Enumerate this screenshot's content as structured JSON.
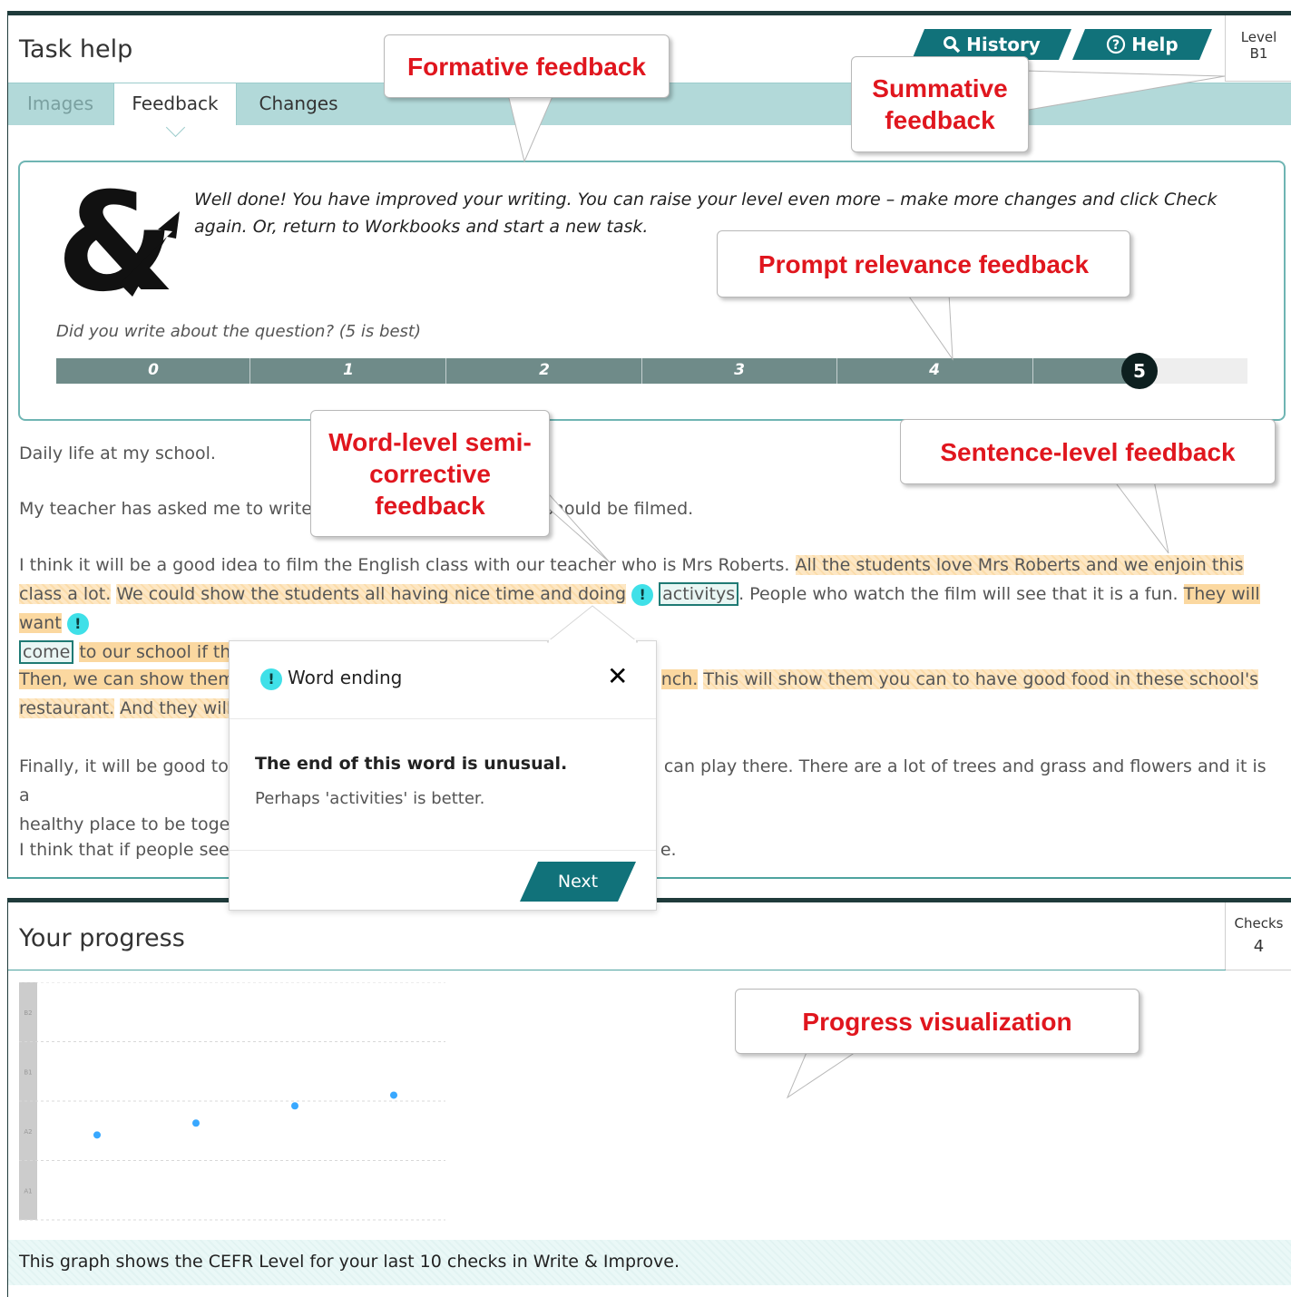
{
  "task_panel": {
    "title": "Task help",
    "history_label": "History",
    "help_label": "Help",
    "level_label": "Level",
    "level_value": "B1",
    "tabs": [
      "Images",
      "Feedback",
      "Changes"
    ],
    "summary_text": "Well done! You have improved your writing. You can raise your level even more – make more changes and click Check again. Or, return to Workbooks and start a new task.",
    "question_label": "Did you write about the question? (5 is best)",
    "scale_labels": [
      "0",
      "1",
      "2",
      "3",
      "4"
    ],
    "scale_value": "5",
    "scale_max": 5
  },
  "essay": {
    "title_line": "Daily life at my school.",
    "p1": "My teacher has asked me to write",
    "p1_end": "should be filmed.",
    "p2_a": "I think it will be a good idea to film the English class with our teacher who is Mrs Roberts.",
    "p2_b": "All the students love Mrs Roberts and we enjoin this class a lot.",
    "p2_c": "We could show the students all having nice time and doing",
    "p2_err_word": "activitys",
    "p2_d": ". People who watch the film will see that it is a fun.",
    "p2_e": "They will want",
    "p2_err_word2": "come",
    "p2_f": "to our school if they see this class.",
    "p3_a": "Then, we can show them",
    "p3_b": "nch.",
    "p3_c": "This will show them you can to have good food in these school's restaurant.",
    "p3_d": "And they will",
    "p4_a": "Finally, it will be good to",
    "p4_b": "can play there. There are a lot of trees and grass and flowers and it is a",
    "p4_c": "healthy place to be toget",
    "p5_a": "I think that if people see",
    "p5_b": "e."
  },
  "popup": {
    "title": "Word ending",
    "heading": "The end of this word is unusual.",
    "suggestion": "Perhaps 'activities' is better.",
    "next_label": "Next",
    "dot_symbol": "!"
  },
  "progress_panel": {
    "title": "Your progress",
    "checks_label": "Checks",
    "checks_value": "4",
    "caption": "This graph shows the CEFR Level for your last 10 checks in Write & Improve.",
    "y_levels": [
      "B2",
      "B1",
      "A2",
      "A1"
    ]
  },
  "chart_data": {
    "type": "scatter",
    "x": [
      1,
      2,
      3,
      4
    ],
    "y": [
      "A2",
      "A2",
      "B1",
      "B1"
    ],
    "y_values": [
      1.93,
      2.13,
      2.42,
      2.6
    ],
    "y_categories": [
      "A1",
      "A2",
      "B1",
      "B2"
    ],
    "ylim": [
      0.5,
      4.5
    ],
    "grid": true,
    "color": "#38a8ff"
  },
  "callouts": {
    "formative": "Formative feedback",
    "summative": "Summative feedback",
    "prompt_relevance": "Prompt relevance feedback",
    "word_level": "Word-level semi-corrective feedback",
    "sentence_level": "Sentence-level feedback",
    "progress_vis": "Progress visualization"
  },
  "colors": {
    "teal": "#11727a",
    "tab_bar": "#b2d9d9",
    "highlight": "#fbd8a0",
    "callout_text": "#e0161e"
  }
}
